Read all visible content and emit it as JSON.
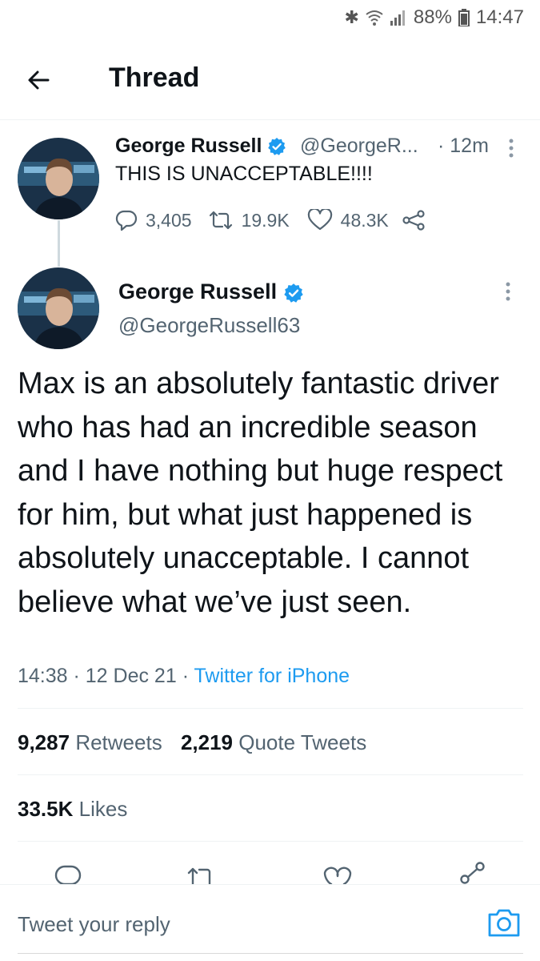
{
  "status_bar": {
    "battery": "88%",
    "time": "14:47",
    "icons": [
      "bluetooth-icon",
      "wifi-icon",
      "signal-icon",
      "battery-icon"
    ]
  },
  "header": {
    "back_icon": "arrow-left-icon",
    "title": "Thread"
  },
  "parent_tweet": {
    "name": "George Russell",
    "handle": "@GeorgeR...",
    "time": "· 12m",
    "text": "THIS IS UNACCEPTABLE!!!!",
    "replies": "3,405",
    "retweets": "19.9K",
    "likes": "48.3K"
  },
  "main_tweet": {
    "name": "George Russell",
    "handle": "@GeorgeRussell63",
    "text": "Max is an absolutely fantastic driver who has had an incredible season and I have nothing but huge respect for him, but what just happened is absolutely unacceptable. I cannot believe what we’ve just seen.",
    "timestamp": "14:38 · 12 Dec 21 · ",
    "source": "Twitter for iPhone",
    "retweets_count": "9,287",
    "retweets_label": "Retweets",
    "quotes_count": "2,219",
    "quotes_label": "Quote Tweets",
    "likes_count": "33.5K",
    "likes_label": "Likes"
  },
  "reply": {
    "placeholder": "Tweet your reply"
  },
  "colors": {
    "accent": "#1d9bf0",
    "text": "#0f1419",
    "muted": "#536471"
  }
}
